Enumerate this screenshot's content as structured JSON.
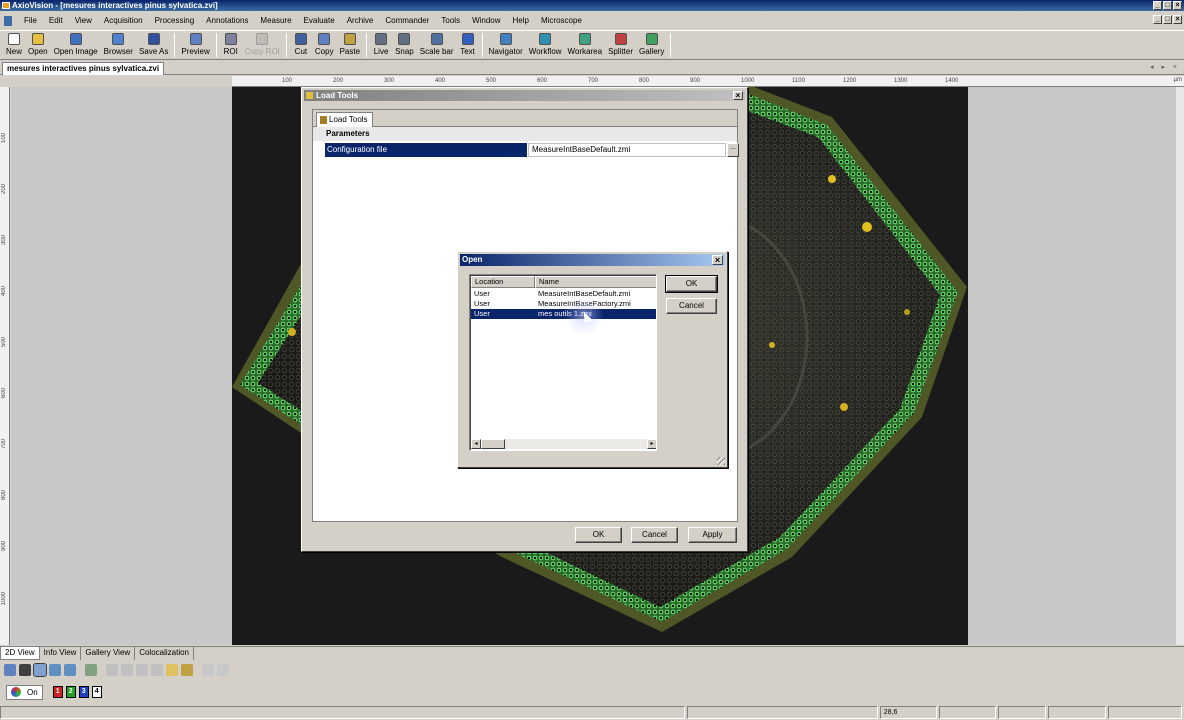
{
  "window": {
    "title": "AxioVision - [mesures interactives pinus sylvatica.zvi]"
  },
  "menu": [
    "File",
    "Edit",
    "View",
    "Acquisition",
    "Processing",
    "Annotations",
    "Measure",
    "Evaluate",
    "Archive",
    "Commander",
    "Tools",
    "Window",
    "Help",
    "Microscope"
  ],
  "toolbar": [
    {
      "label": "New",
      "icon": "new-document-icon",
      "enabled": true,
      "color": "#ffffff"
    },
    {
      "label": "Open",
      "icon": "open-folder-icon",
      "enabled": true,
      "color": "#e8c040"
    },
    {
      "label": "Open Image",
      "icon": "open-image-icon",
      "enabled": true,
      "color": "#4070c0"
    },
    {
      "label": "Browser",
      "icon": "browser-icon",
      "enabled": true,
      "color": "#5080d0"
    },
    {
      "label": "Save As",
      "icon": "save-icon",
      "enabled": true,
      "color": "#3050a0"
    },
    {
      "label": "Preview",
      "icon": "preview-icon",
      "enabled": true,
      "color": "#6080c0"
    },
    {
      "label": "ROI",
      "icon": "roi-icon",
      "enabled": true,
      "color": "#8080a0"
    },
    {
      "label": "Copy ROI",
      "icon": "copy-roi-icon",
      "enabled": false,
      "color": "#a0a0a0"
    },
    {
      "label": "Cut",
      "icon": "cut-icon",
      "enabled": true,
      "color": "#4060a0"
    },
    {
      "label": "Copy",
      "icon": "copy-icon",
      "enabled": true,
      "color": "#6080c0"
    },
    {
      "label": "Paste",
      "icon": "paste-icon",
      "enabled": true,
      "color": "#c0a040"
    },
    {
      "label": "Live",
      "icon": "live-camera-icon",
      "enabled": true,
      "color": "#607080"
    },
    {
      "label": "Snap",
      "icon": "snap-camera-icon",
      "enabled": true,
      "color": "#607080"
    },
    {
      "label": "Scale bar",
      "icon": "scale-bar-icon",
      "enabled": true,
      "color": "#5070a0"
    },
    {
      "label": "Text",
      "icon": "text-icon",
      "enabled": true,
      "color": "#3060c0"
    },
    {
      "label": "Navigator",
      "icon": "navigator-icon",
      "enabled": true,
      "color": "#4080c0"
    },
    {
      "label": "Workflow",
      "icon": "workflow-icon",
      "enabled": true,
      "color": "#3090b0"
    },
    {
      "label": "Workarea",
      "icon": "workarea-icon",
      "enabled": true,
      "color": "#40a080"
    },
    {
      "label": "Splitter",
      "icon": "splitter-icon",
      "enabled": true,
      "color": "#c04040"
    },
    {
      "label": "Gallery",
      "icon": "gallery-icon",
      "enabled": true,
      "color": "#40a060"
    }
  ],
  "doc_tab": "mesures interactives pinus sylvatica.zvi",
  "ruler": {
    "h_ticks": [
      "100",
      "200",
      "300",
      "400",
      "500",
      "600",
      "700",
      "800",
      "900",
      "1000",
      "1100",
      "1200",
      "1300",
      "1400"
    ],
    "unit": "µm",
    "v_ticks": [
      "100",
      "200",
      "300",
      "400",
      "500",
      "600",
      "700",
      "800",
      "900",
      "1000"
    ]
  },
  "load_tools": {
    "title": "Load Tools",
    "tab": "Load Tools",
    "section": "Parameters",
    "param_name": "Configuration file",
    "param_value": "MeasureIntBaseDefault.zmi",
    "browse": "...",
    "ok": "OK",
    "cancel": "Cancel",
    "apply": "Apply"
  },
  "open_dialog": {
    "title": "Open",
    "columns": [
      "Location",
      "Name"
    ],
    "rows": [
      {
        "location": "User",
        "name": "MeasureIntBaseDefault.zmi",
        "selected": false
      },
      {
        "location": "User",
        "name": "MeasureIntBaseFactory.zmi",
        "selected": false
      },
      {
        "location": "User",
        "name": "mes outils 1.zmi",
        "selected": true
      }
    ],
    "ok": "OK",
    "cancel": "Cancel"
  },
  "view_tabs": [
    "2D View",
    "Info View",
    "Gallery View",
    "Colocalization"
  ],
  "channels": {
    "on_label": "On",
    "chips": [
      {
        "label": "1",
        "color": "#d02020"
      },
      {
        "label": "2",
        "color": "#20a020"
      },
      {
        "label": "3",
        "color": "#2040c0"
      },
      {
        "label": "4",
        "color": "#ffffff"
      }
    ]
  },
  "status": {
    "value": "28,6"
  }
}
